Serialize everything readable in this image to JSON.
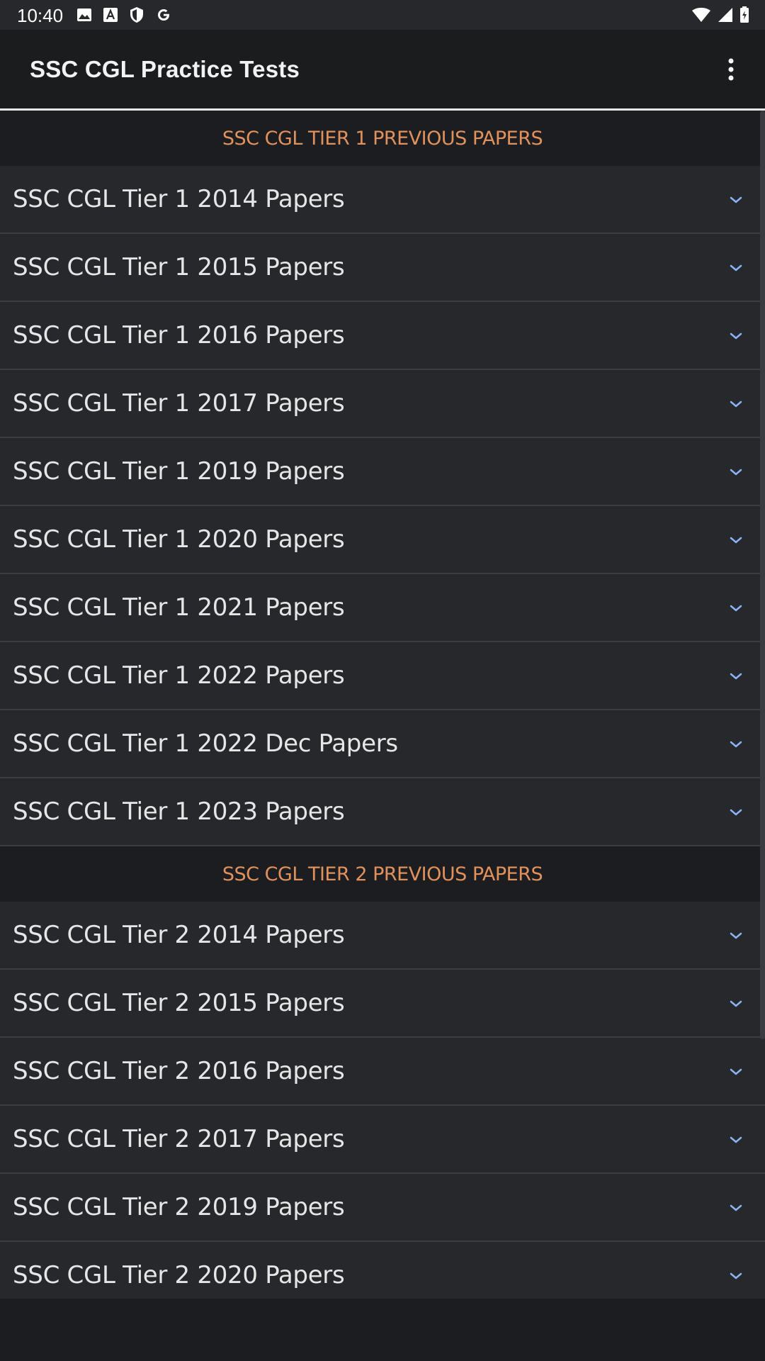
{
  "status_bar": {
    "time": "10:40",
    "icons_left": [
      "image-icon",
      "a-letter-icon",
      "shield-icon",
      "google-icon"
    ],
    "icons_right": [
      "wifi-icon",
      "signal-icon",
      "battery-icon"
    ]
  },
  "app_bar": {
    "title": "SSC CGL Practice Tests",
    "menu_icon": "more-vert-icon"
  },
  "colors": {
    "section_header_text": "#e0915c",
    "row_background": "#27282c",
    "chevron": "#8ab4f8"
  },
  "sections": [
    {
      "header": "SSC CGL TIER 1 PREVIOUS PAPERS",
      "items": [
        "SSC CGL Tier 1 2014 Papers",
        "SSC CGL Tier 1 2015 Papers",
        "SSC CGL Tier 1 2016 Papers",
        "SSC CGL Tier 1 2017 Papers",
        "SSC CGL Tier 1 2019 Papers",
        "SSC CGL Tier 1 2020 Papers",
        "SSC CGL Tier 1 2021 Papers",
        "SSC CGL Tier 1 2022 Papers",
        "SSC CGL Tier 1 2022 Dec Papers",
        "SSC CGL Tier 1 2023 Papers"
      ]
    },
    {
      "header": "SSC CGL TIER 2 PREVIOUS PAPERS",
      "items": [
        "SSC CGL Tier 2 2014 Papers",
        "SSC CGL Tier 2 2015 Papers",
        "SSC CGL Tier 2 2016 Papers",
        "SSC CGL Tier 2 2017 Papers",
        "SSC CGL Tier 2 2019 Papers",
        "SSC CGL Tier 2 2020 Papers"
      ]
    }
  ]
}
